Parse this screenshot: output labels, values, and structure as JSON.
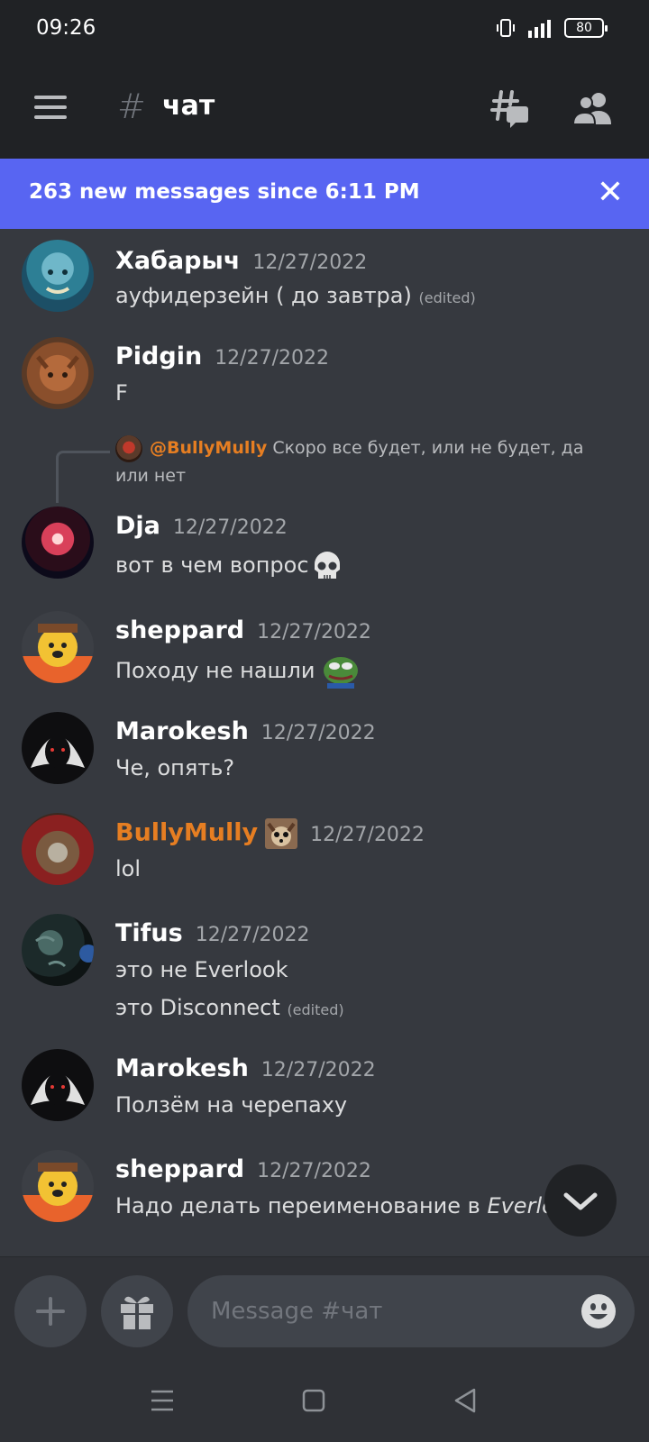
{
  "status_bar": {
    "time": "09:26",
    "battery": "80"
  },
  "header": {
    "channel_name": "чат"
  },
  "banner": {
    "text": "263 new messages since 6:11 PM",
    "close": "✕"
  },
  "messages": [
    {
      "author": "Хабарыч",
      "timestamp": "12/27/2022",
      "lines": [
        "ауфидерзейн ( до завтра)"
      ],
      "edited": "(edited)"
    },
    {
      "author": "Pidgin",
      "timestamp": "12/27/2022",
      "lines": [
        "F"
      ]
    },
    {
      "reply_mention": "@BullyMully",
      "reply_text": "Скоро все будет, или не будет, да или нет",
      "author": "Dja",
      "timestamp": "12/27/2022",
      "lines": [
        "вот в чем вопрос"
      ],
      "emoji": "skull"
    },
    {
      "author": "sheppard",
      "timestamp": "12/27/2022",
      "lines": [
        "Походу не нашли"
      ],
      "emoji": "pepe"
    },
    {
      "author": "Marokesh",
      "timestamp": "12/27/2022",
      "lines": [
        "Че, опять?"
      ]
    },
    {
      "author": "BullyMully",
      "timestamp": "12/27/2022",
      "lines": [
        "lol"
      ],
      "author_color": "#e67e22"
    },
    {
      "author": "Tifus",
      "timestamp": "12/27/2022",
      "lines": [
        "это не Everlook",
        "это Disconnect"
      ],
      "edited": "(edited)"
    },
    {
      "author": "Marokesh",
      "timestamp": "12/27/2022",
      "lines": [
        "Ползём на черепаху"
      ]
    },
    {
      "author": "sheppard",
      "timestamp": "12/27/2022",
      "lines": [
        "Надо делать переименование в "
      ],
      "italic": "Everloop"
    }
  ],
  "composer": {
    "placeholder": "Message #чат"
  },
  "colors": {
    "accent": "#5865f2",
    "background": "#36393f",
    "header": "#202225",
    "mention": "#e67e22"
  }
}
